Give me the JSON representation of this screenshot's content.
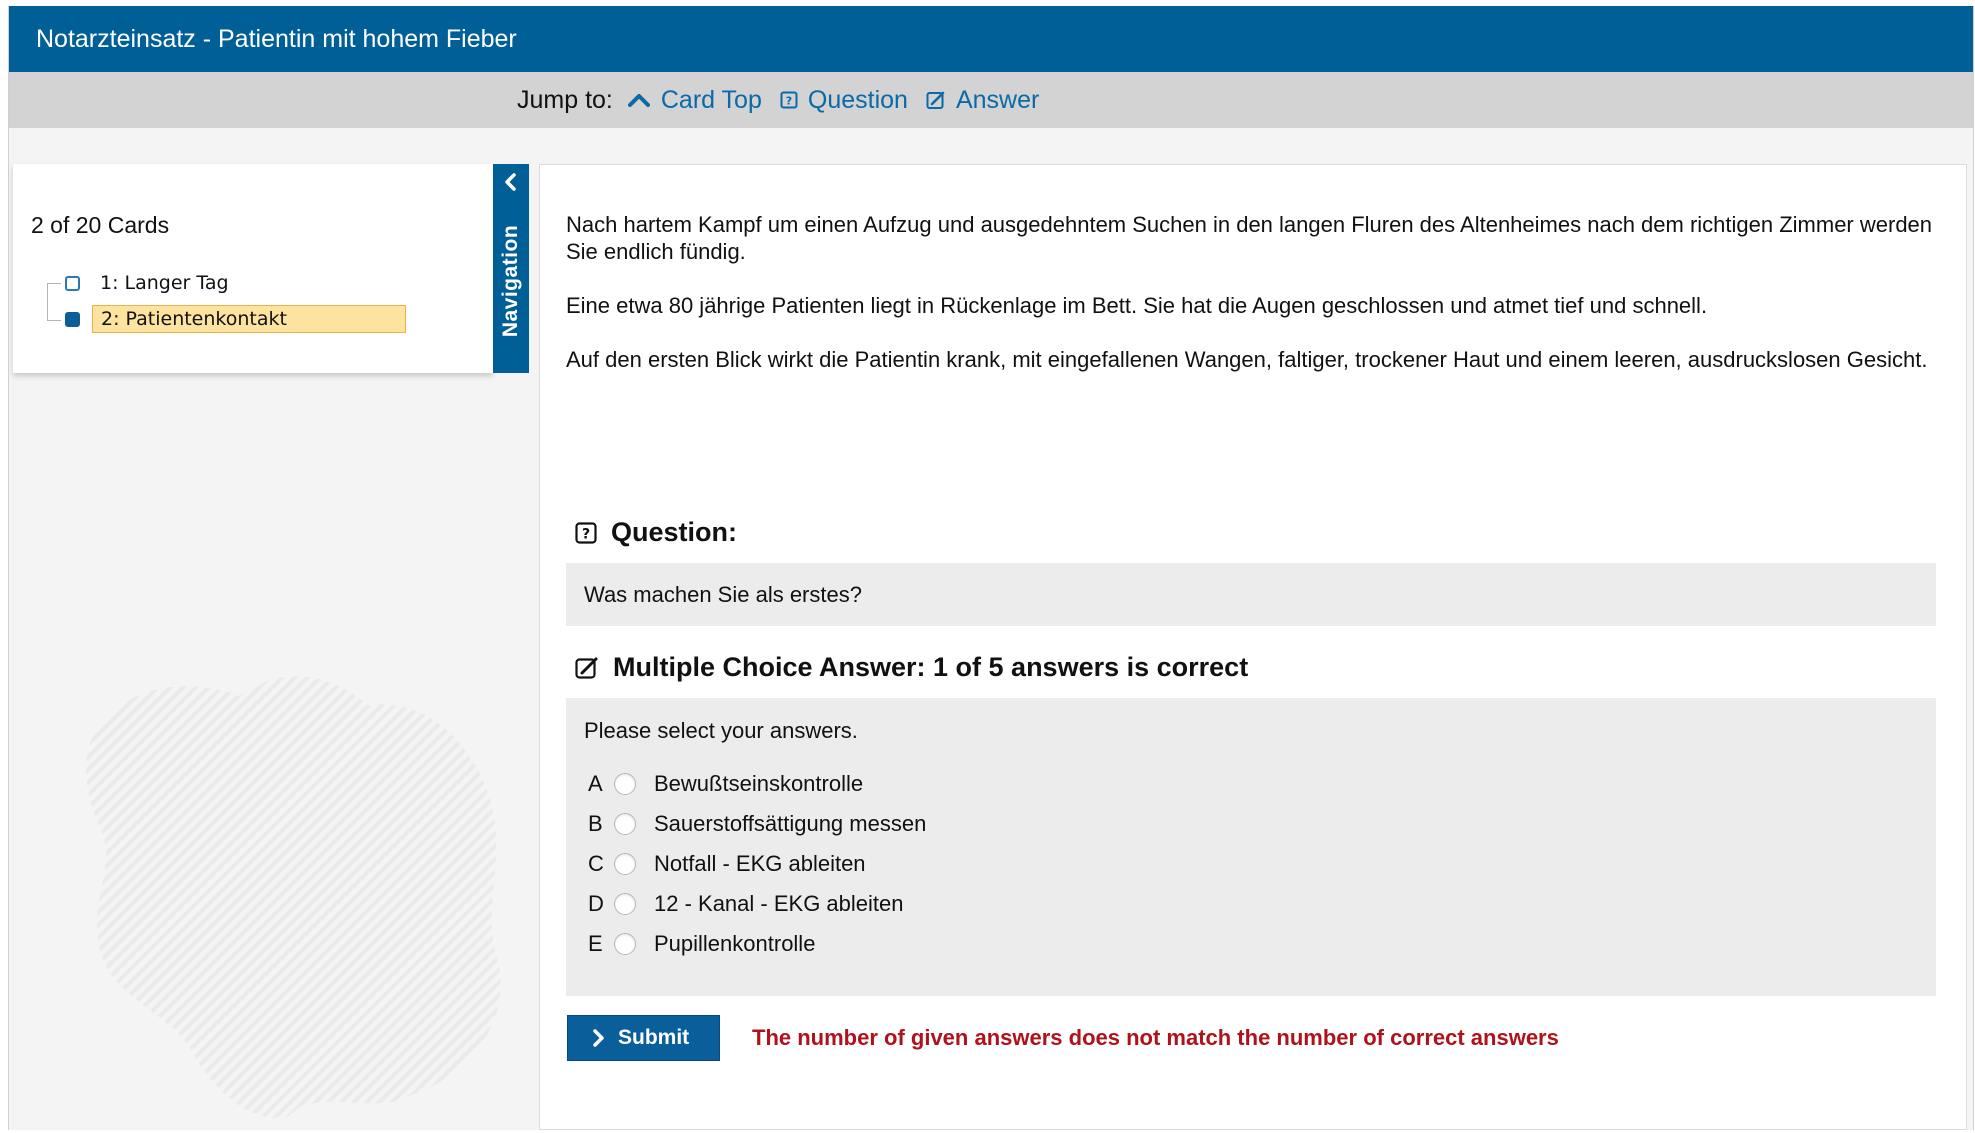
{
  "window": {
    "title": "Notarzteinsatz - Patientin mit hohem Fieber"
  },
  "jumpbar": {
    "label": "Jump to:",
    "links": [
      {
        "label": "Card Top",
        "icon": "chevron-up-icon"
      },
      {
        "label": "Question",
        "icon": "question-box-icon"
      },
      {
        "label": "Answer",
        "icon": "edit-box-icon"
      }
    ]
  },
  "navigation": {
    "tab_label": "Navigation",
    "count": "2 of 20 Cards",
    "items": [
      {
        "label": "1: Langer Tag",
        "active": false
      },
      {
        "label": "2: Patientenkontakt",
        "active": true
      }
    ]
  },
  "card": {
    "paragraphs": [
      "Nach hartem Kampf um einen Aufzug und ausgedehntem Suchen in den langen Fluren des Altenheimes nach dem richtigen Zimmer werden Sie endlich fündig.",
      "Eine etwa 80 jährige Patienten liegt in Rückenlage im Bett. Sie hat die Augen geschlossen und atmet tief und schnell.",
      "Auf den ersten Blick wirkt die Patientin krank, mit eingefallenen Wangen, faltiger, trockener Haut und einem leeren, ausdruckslosen Gesicht."
    ],
    "question": {
      "heading": "Question:",
      "text": "Was machen Sie als erstes?"
    },
    "answer": {
      "heading": "Multiple Choice Answer: 1 of 5 answers is correct",
      "hint": "Please select your answers.",
      "options": [
        {
          "letter": "A",
          "label": "Bewußtseinskontrolle"
        },
        {
          "letter": "B",
          "label": "Sauerstoffsättigung messen"
        },
        {
          "letter": "C",
          "label": "Notfall - EKG ableiten"
        },
        {
          "letter": "D",
          "label": "12 - Kanal - EKG ableiten"
        },
        {
          "letter": "E",
          "label": "Pupillenkontrolle"
        }
      ]
    },
    "submit_label": "Submit",
    "error": "The number of given answers does not match the number of correct answers"
  },
  "colors": {
    "brand": "#005f96",
    "link": "#0a6aa8",
    "error": "#b0121b",
    "active_item": "#fde3a0"
  }
}
